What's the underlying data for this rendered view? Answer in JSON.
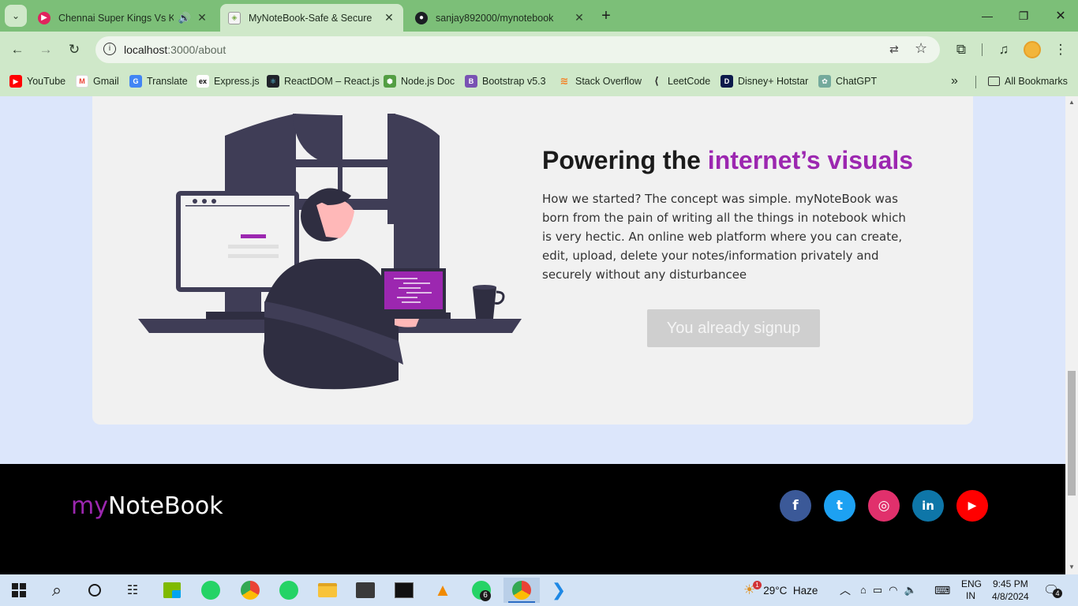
{
  "tabs": [
    {
      "title": "Chennai Super Kings Vs Kolkata Knight Riders",
      "favicon": "youtube-music-icon",
      "color": "#e0245e"
    },
    {
      "title": "MyNoteBook-Safe & Secure",
      "favicon": "shield-icon",
      "color": "#6b6b6b"
    },
    {
      "title": "sanjay892000/mynotebook",
      "favicon": "github-icon",
      "color": "#1b1f23"
    }
  ],
  "address": {
    "host": "localhost",
    "path": ":3000/about"
  },
  "bookmarks": [
    {
      "label": "YouTube",
      "icon": "youtube-icon",
      "color": "#ff0000"
    },
    {
      "label": "Gmail",
      "icon": "gmail-icon",
      "color": "#ea4335"
    },
    {
      "label": "Translate",
      "icon": "translate-icon",
      "color": "#4285f4"
    },
    {
      "label": "Express.js",
      "icon": "express-icon",
      "color": "#000000"
    },
    {
      "label": "ReactDOM – React.js",
      "icon": "react-icon",
      "color": "#20232a"
    },
    {
      "label": "Node.js Doc",
      "icon": "node-icon",
      "color": "#539e43"
    },
    {
      "label": "Bootstrap v5.3",
      "icon": "bootstrap-icon",
      "color": "#7952b3"
    },
    {
      "label": "Stack Overflow",
      "icon": "stackoverflow-icon",
      "color": "#f48024"
    },
    {
      "label": "LeetCode",
      "icon": "leetcode-icon",
      "color": "#ffa116"
    },
    {
      "label": "Disney+ Hotstar",
      "icon": "hotstar-icon",
      "color": "#0c1a4b"
    },
    {
      "label": "ChatGPT",
      "icon": "chatgpt-icon",
      "color": "#74aa9c"
    }
  ],
  "all_bookmarks": "All Bookmarks",
  "about": {
    "heading_plain": "Powering the ",
    "heading_accent": "internet’s visuals",
    "text": "How we started? The concept was simple. myNoteBook was born from the pain of writing all the things in notebook which is very hectic. An online web platform where you can create, edit, upload, delete your notes/information privately and securely without any disturbancee",
    "button": "You already signup"
  },
  "footer": {
    "brand_my": "my",
    "brand_rest": "NoteBook",
    "social": [
      {
        "name": "facebook",
        "glyph": "f",
        "color": "#3b5998"
      },
      {
        "name": "twitter",
        "glyph": "t",
        "color": "#1da1f2"
      },
      {
        "name": "instagram",
        "glyph": "◎",
        "color": "#e1306c"
      },
      {
        "name": "linkedin",
        "glyph": "in",
        "color": "#0e76a8"
      },
      {
        "name": "youtube",
        "glyph": "▶",
        "color": "#ff0000"
      }
    ]
  },
  "taskbar": {
    "weather": "29°C  Haze",
    "weather_badge": "1",
    "lang_top": "ENG",
    "lang_bottom": "IN",
    "time": "9:45 PM",
    "date": "4/8/2024",
    "notifications": "4",
    "whatsapp_badge": "6"
  }
}
